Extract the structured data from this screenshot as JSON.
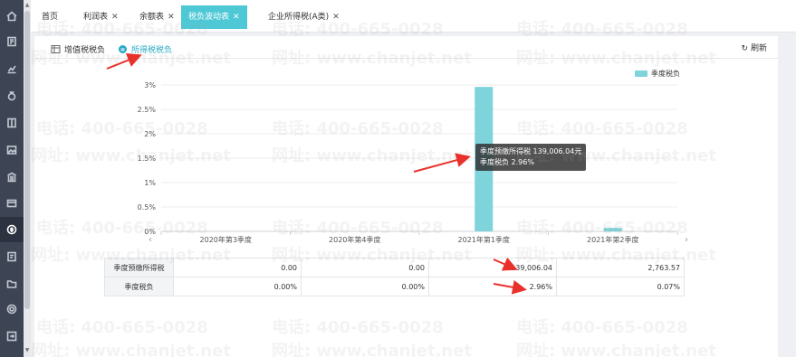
{
  "rail": {
    "icons": [
      "home-icon",
      "report-icon",
      "chart-icon",
      "money-bag-icon",
      "ledger-icon",
      "image-icon",
      "building-icon",
      "card-icon",
      "tax-icon",
      "invoice-icon",
      "folder-icon",
      "settings-icon",
      "export-icon"
    ]
  },
  "tabs": [
    {
      "label": "首页"
    },
    {
      "label": "利润表"
    },
    {
      "label": "余额表"
    },
    {
      "label": "税负波动表"
    },
    {
      "label": "企业所得税(A类)"
    }
  ],
  "subtabs": {
    "vat": "增值税税负",
    "income": "所得税税负"
  },
  "refresh_label": "刷新",
  "legend_label": "季度税负",
  "tooltip": {
    "line1": "季度预缴所得税 139,006.04元",
    "line2": "季度税负 2.96%"
  },
  "chart_data": {
    "type": "bar",
    "categories": [
      "2020年第3季度",
      "2020年第4季度",
      "2021年第1季度",
      "2021年第2季度"
    ],
    "series": [
      {
        "name": "季度税负",
        "values": [
          0.0,
          0.0,
          2.96,
          0.07
        ]
      }
    ],
    "ylim": [
      0,
      3
    ],
    "yticks": [
      "0%",
      "0.5%",
      "1%",
      "1.5%",
      "2%",
      "2.5%",
      "3%"
    ],
    "legend": "top-right",
    "color": "#7fd3da"
  },
  "table": {
    "rows": [
      {
        "label": "季度预缴所得税",
        "values": [
          "0.00",
          "0.00",
          "139,006.04",
          "2,763.57"
        ]
      },
      {
        "label": "季度税负",
        "values": [
          "0.00%",
          "0.00%",
          "2.96%",
          "0.07%"
        ]
      }
    ]
  },
  "watermark": {
    "phone": "电话: 400-665-0028",
    "site": "网址: www.chanjet.net"
  },
  "colors": {
    "accent": "#4fc8d6",
    "bar": "#7fd3da",
    "arrow": "#e8312b"
  }
}
